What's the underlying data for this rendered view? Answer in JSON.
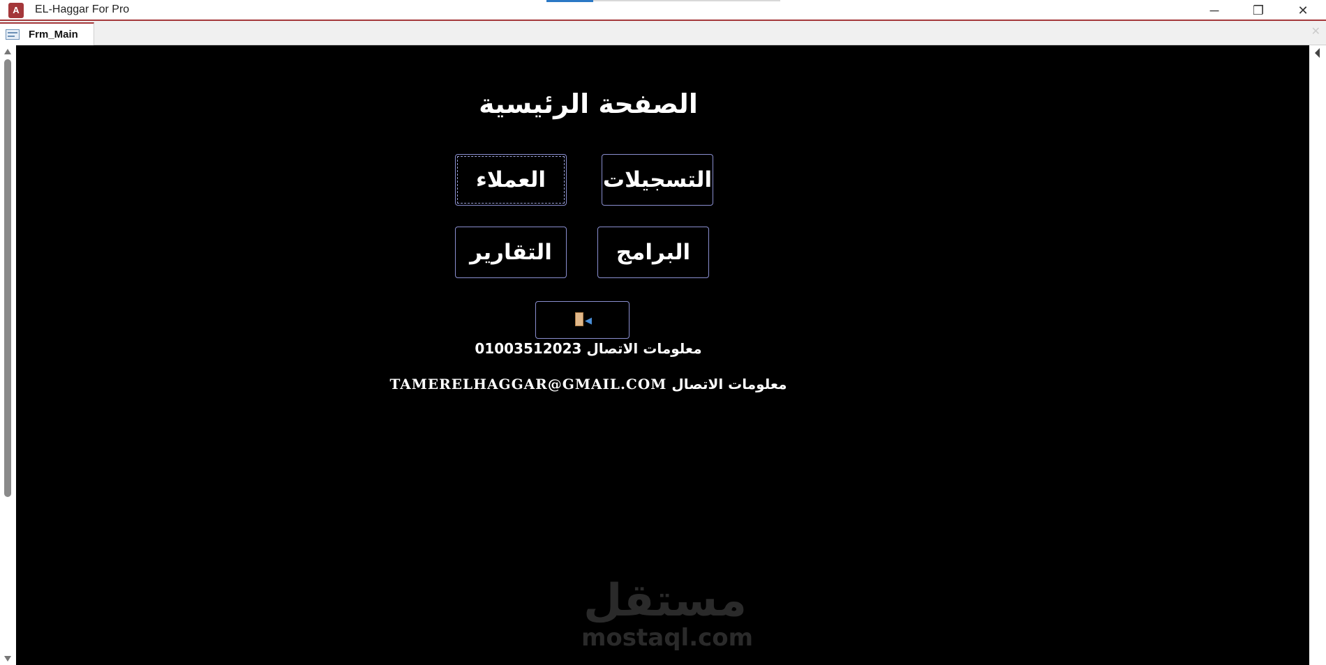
{
  "window": {
    "title": "EL-Haggar For Pro",
    "app_icon": "access-icon",
    "app_icon_letter": "A",
    "minimize": "─",
    "maximize": "❐",
    "close": "✕"
  },
  "tab": {
    "label": "Frm_Main",
    "icon": "form-icon",
    "close": "✕"
  },
  "form": {
    "heading": "الصفحة الرئيسية",
    "buttons": {
      "registrations": "التسجيلات",
      "clients": "العملاء",
      "programs": "البرامج",
      "reports": "التقارير"
    },
    "exit_icon": "exit-door-icon",
    "contact": [
      {
        "label": "معلومات الاتصال",
        "value": "01003512023"
      },
      {
        "label": "معلومات الاتصال",
        "value": "TAMERELHAGGAR@GMAIL.COM"
      }
    ]
  },
  "watermark": {
    "arabic": "مستقل",
    "latin": "mostaql.com"
  },
  "colors": {
    "accent": "#a4373a",
    "canvas": "#000000",
    "button_border": "#8a8fd0"
  }
}
